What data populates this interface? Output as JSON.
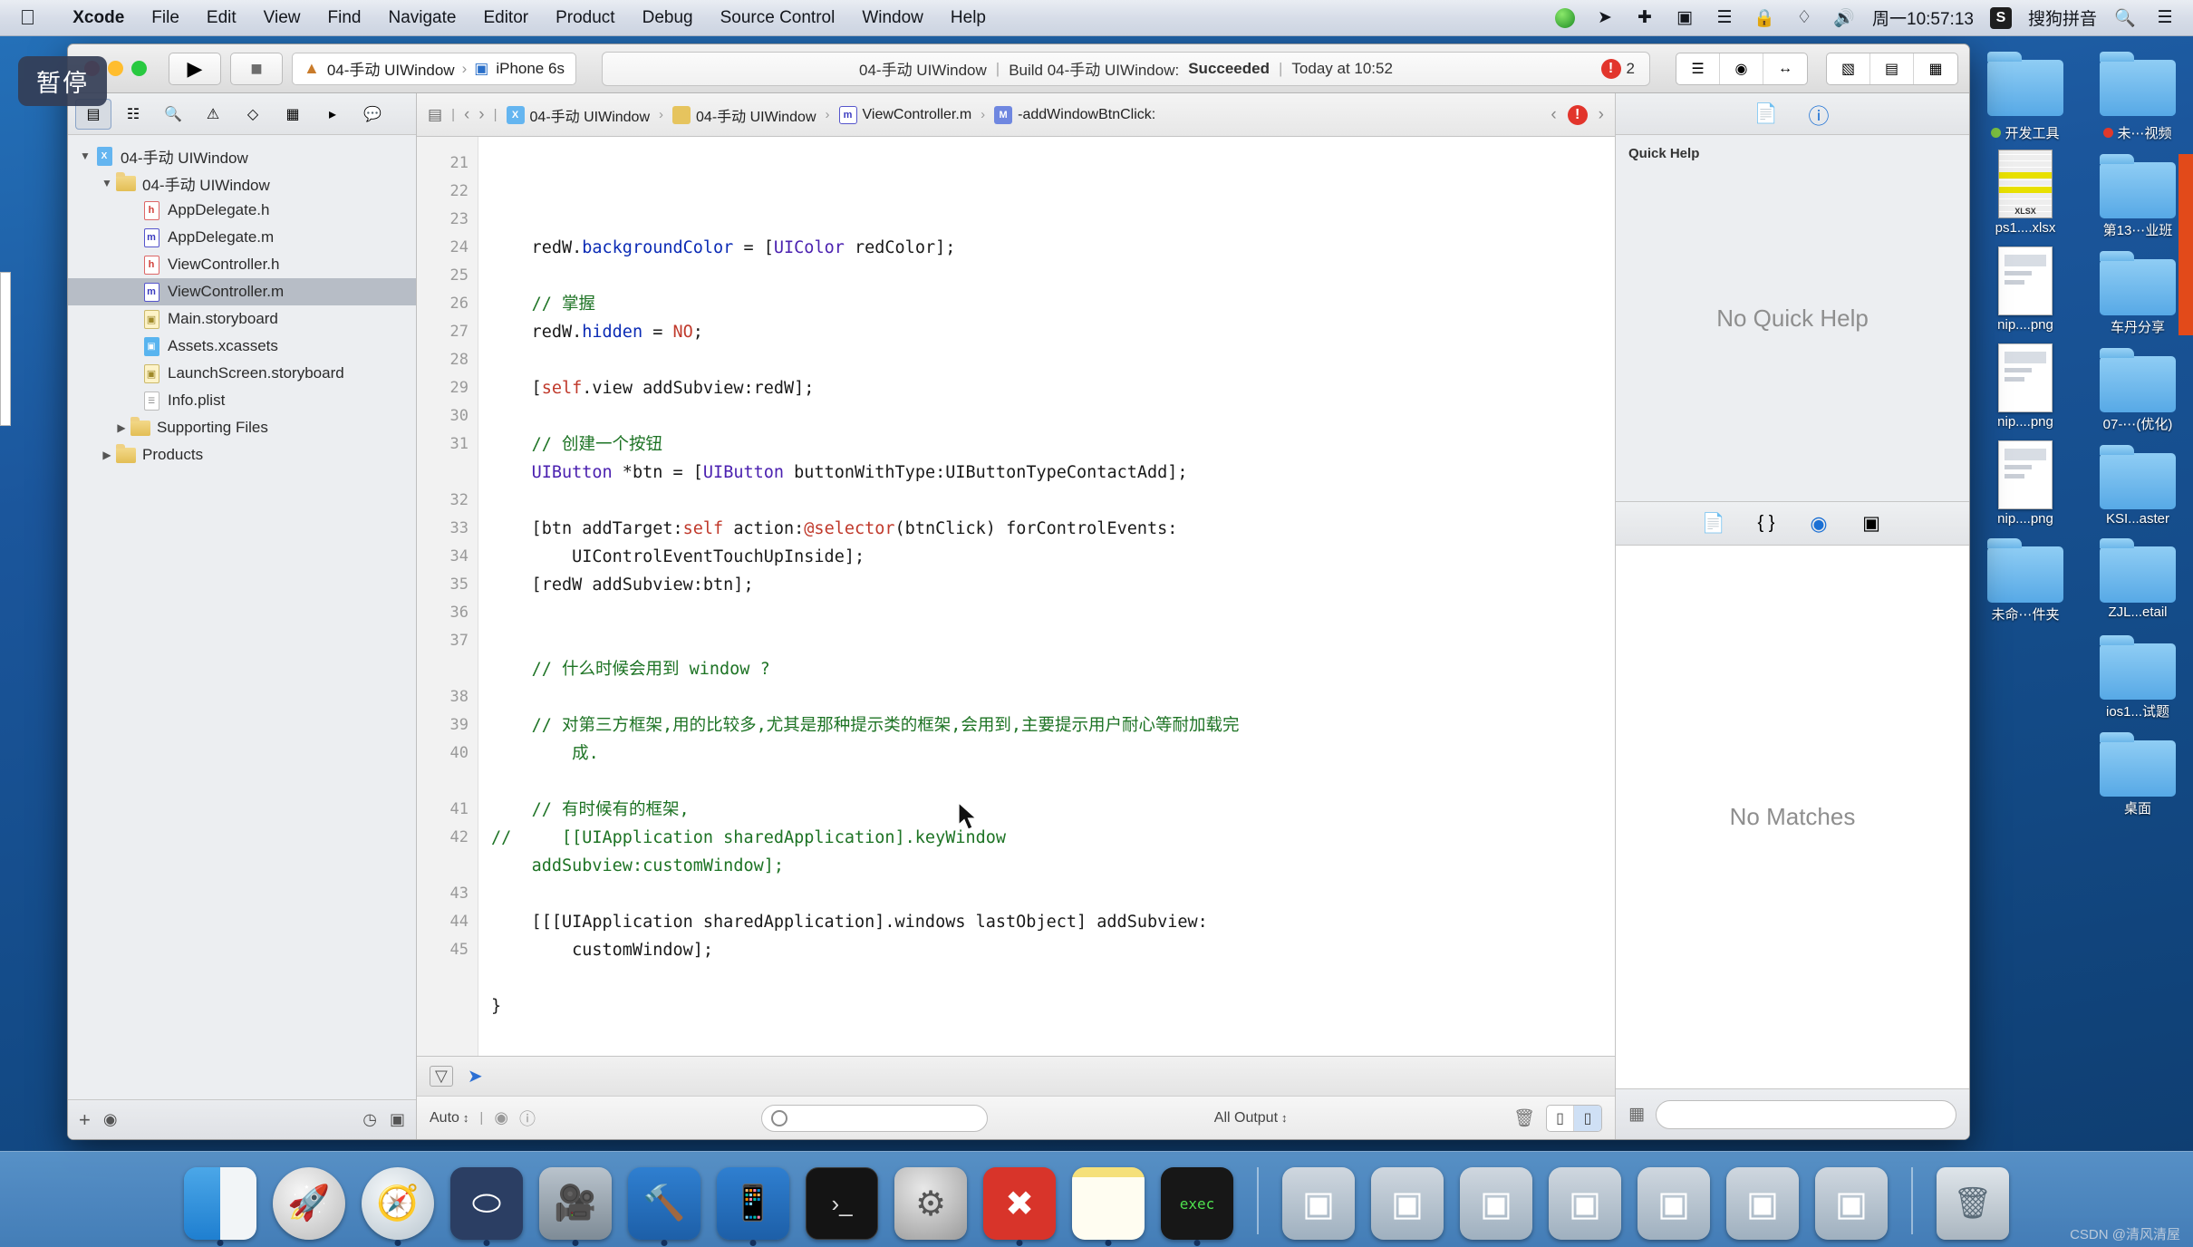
{
  "menubar": {
    "apple": "",
    "items": [
      "Xcode",
      "File",
      "Edit",
      "View",
      "Find",
      "Navigate",
      "Editor",
      "Product",
      "Debug",
      "Source Control",
      "Window",
      "Help"
    ],
    "status_icons": [
      "record-icon",
      "location-icon",
      "airplay-icon",
      "screen-record-icon",
      "audio-midi-icon",
      "lock-icon",
      "dropbox-icon",
      "volume-icon"
    ],
    "time": "周一10:57:13",
    "ime_badge": "S",
    "ime_label": "搜狗拼音",
    "search_icon": "search-icon",
    "control_center_icon": "list-icon"
  },
  "pause_badge": "暂停",
  "toolbar": {
    "run_icon": "play-icon",
    "stop_icon": "stop-icon",
    "scheme_name": "04-手动 UIWindow",
    "scheme_sep": "›",
    "destination": "iPhone 6s",
    "status_project": "04-手动 UIWindow",
    "status_build": "Build 04-手动 UIWindow:",
    "status_result": "Succeeded",
    "status_time": "Today at 10:52",
    "issue_count": "2",
    "issue_icon": "error-icon",
    "view_buttons": [
      "standard-editor-icon",
      "assistant-editor-icon",
      "version-editor-icon"
    ],
    "panel_buttons": [
      "show-navigator-icon",
      "show-debug-icon",
      "show-inspector-icon"
    ]
  },
  "navigator": {
    "tabs": [
      "project-navigator-icon",
      "symbol-navigator-icon",
      "find-navigator-icon",
      "issue-navigator-icon",
      "test-navigator-icon",
      "debug-navigator-icon",
      "breakpoint-navigator-icon",
      "report-navigator-icon"
    ],
    "active_tab": 0,
    "tree": [
      {
        "label": "04-手动 UIWindow",
        "icon": "xcode-project-icon",
        "depth": 0,
        "twisty": "▼",
        "selected": false
      },
      {
        "label": "04-手动 UIWindow",
        "icon": "folder-icon",
        "depth": 1,
        "twisty": "▼",
        "selected": false
      },
      {
        "label": "AppDelegate.h",
        "icon": "header-file-icon",
        "depth": 2,
        "twisty": "",
        "selected": false
      },
      {
        "label": "AppDelegate.m",
        "icon": "impl-file-icon",
        "depth": 2,
        "twisty": "",
        "selected": false
      },
      {
        "label": "ViewController.h",
        "icon": "header-file-icon",
        "depth": 2,
        "twisty": "",
        "selected": false
      },
      {
        "label": "ViewController.m",
        "icon": "impl-file-icon",
        "depth": 2,
        "twisty": "",
        "selected": true
      },
      {
        "label": "Main.storyboard",
        "icon": "storyboard-icon",
        "depth": 2,
        "twisty": "",
        "selected": false
      },
      {
        "label": "Assets.xcassets",
        "icon": "assets-icon",
        "depth": 2,
        "twisty": "",
        "selected": false
      },
      {
        "label": "LaunchScreen.storyboard",
        "icon": "storyboard-icon",
        "depth": 2,
        "twisty": "",
        "selected": false
      },
      {
        "label": "Info.plist",
        "icon": "plist-icon",
        "depth": 2,
        "twisty": "",
        "selected": false
      },
      {
        "label": "Supporting Files",
        "icon": "folder-icon",
        "depth": 2,
        "twisty": "▶",
        "selected": false
      },
      {
        "label": "Products",
        "icon": "folder-icon",
        "depth": 1,
        "twisty": "▶",
        "selected": false
      }
    ],
    "bottom": {
      "add_icon": "plus-icon",
      "filter_icon": "filter-icon",
      "recent_icon": "clock-icon",
      "unsaved_icon": "edited-icon"
    }
  },
  "jumpbar": {
    "related_icon": "related-items-icon",
    "back_icon": "back-chevron-icon",
    "forward_icon": "forward-chevron-icon",
    "crumbs": [
      {
        "label": "04-手动 UIWindow",
        "icon": "project-icon"
      },
      {
        "label": "04-手动 UIWindow",
        "icon": "folder-icon"
      },
      {
        "label": "ViewController.m",
        "icon": "impl-file-icon"
      },
      {
        "label": "-addWindowBtnClick:",
        "icon": "method-icon"
      }
    ],
    "prev_issue_icon": "left-chevron-icon",
    "issue_icon": "error-icon",
    "next_issue_icon": "right-chevron-icon"
  },
  "code": {
    "first_line": 21,
    "lines": [
      {
        "n": 21,
        "html": "    redW.<span class='k'>backgroundColor</span> = [<span class='t'>UIColor</span> redColor];",
        "error": false
      },
      {
        "n": 22,
        "html": "",
        "error": false
      },
      {
        "n": 23,
        "html": "    <span class='c'>// 掌握</span>",
        "error": false
      },
      {
        "n": 24,
        "html": "    redW.<span class='k'>hidden</span> = <span class='red'>NO</span>;",
        "error": false
      },
      {
        "n": 25,
        "html": "",
        "error": false
      },
      {
        "n": 26,
        "html": "    [<span class='red'>self</span>.view addSubview:redW];",
        "error": false
      },
      {
        "n": 27,
        "html": "",
        "error": false
      },
      {
        "n": 28,
        "html": "    <span class='c'>// 创建一个按钮</span>",
        "error": false
      },
      {
        "n": 29,
        "html": "    <span class='t'>UIButton</span> *btn = [<span class='t'>UIButton</span> buttonWithType:UIButtonTypeContactAdd];",
        "error": false
      },
      {
        "n": 30,
        "html": "",
        "error": false
      },
      {
        "n": 31,
        "html": "    [btn addTarget:<span class='red'>self</span> action:<span class='red'>@selector</span>(btnClick) forControlEvents:",
        "error": false
      },
      {
        "n": "",
        "html": "        UIControlEventTouchUpInside];",
        "error": false
      },
      {
        "n": 32,
        "html": "    [redW addSubview:btn];",
        "error": false
      },
      {
        "n": 33,
        "html": "",
        "error": false
      },
      {
        "n": 34,
        "html": "",
        "error": false
      },
      {
        "n": 35,
        "html": "    <span class='c'>// 什么时候会用到 window ?</span>",
        "error": false
      },
      {
        "n": 36,
        "html": "",
        "error": false
      },
      {
        "n": 37,
        "html": "    <span class='c'>// 对第三方框架,用的比较多,尤其是那种提示类的框架,会用到,主要提示用户耐心等耐加载完</span>",
        "error": false
      },
      {
        "n": "",
        "html": "        <span class='c'>成.</span>",
        "error": false
      },
      {
        "n": 38,
        "html": "",
        "error": false
      },
      {
        "n": 39,
        "html": "    <span class='c'>// 有时候有的框架,</span>",
        "error": false
      },
      {
        "n": 40,
        "html": "<span class='c'>//     [[UIApplication sharedApplication].keyWindow</span>",
        "error": false
      },
      {
        "n": "",
        "html": "    <span class='c'>addSubview:customWindow];</span>",
        "error": false
      },
      {
        "n": 41,
        "html": "",
        "error": false
      },
      {
        "n": 42,
        "html": "    [[[UIApplication sharedApplication].windows lastObject] addSubview:",
        "error": false
      },
      {
        "n": "",
        "html": "        customWindow];",
        "error": false
      },
      {
        "n": 43,
        "html": "",
        "error": false
      },
      {
        "n": 44,
        "html": "}",
        "error": true
      },
      {
        "n": 45,
        "html": "",
        "error": false
      }
    ]
  },
  "editor_bottom": {
    "filter_icon": "filter-icon",
    "breakpoint_icon": "breakpoint-icon"
  },
  "debug": {
    "variables_scope": "Auto",
    "scope_chevron": "⌃",
    "watch_icon": "eye-icon",
    "info_icon": "info-icon",
    "var_filter_placeholder": "",
    "console_scope": "All Output",
    "console_chevron": "⌃",
    "trash_icon": "trash-icon",
    "split_icon": "split-panes-icon"
  },
  "inspector": {
    "tabs": [
      "file-inspector-icon",
      "quick-help-icon"
    ],
    "active_tab": 1,
    "section_title": "Quick Help",
    "empty_message": "No Quick Help",
    "library_tabs": [
      "file-template-library-icon",
      "code-snippet-library-icon",
      "object-library-icon",
      "media-library-icon"
    ],
    "library_active": 2,
    "library_empty": "No Matches",
    "library_filter_placeholder": "",
    "list_view_icon": "list-view-icon",
    "filter_icon": "filter-icon"
  },
  "desktop_icons": [
    {
      "label": "",
      "type": "folder"
    },
    {
      "label": "",
      "type": "folder"
    },
    {
      "label": "开发工具",
      "type": "label-green"
    },
    {
      "label": "未⋯视频",
      "type": "label-red"
    },
    {
      "label": "ps1....xlsx",
      "type": "xlsx"
    },
    {
      "label": "第13⋯业班",
      "type": "folder"
    },
    {
      "label": "nip....png",
      "type": "png"
    },
    {
      "label": "车丹分享",
      "type": "folder"
    },
    {
      "label": "nip....png",
      "type": "png"
    },
    {
      "label": "07-⋯(优化)",
      "type": "folder"
    },
    {
      "label": "nip....png",
      "type": "png"
    },
    {
      "label": "KSI...aster",
      "type": "folder"
    },
    {
      "label": "未命⋯件夹",
      "type": "folder"
    },
    {
      "label": "ZJL...etail",
      "type": "folder"
    },
    {
      "label": "",
      "type": "spacer"
    },
    {
      "label": "ios1...试题",
      "type": "folder"
    },
    {
      "label": "",
      "type": "spacer"
    },
    {
      "label": "桌面",
      "type": "folder"
    }
  ],
  "dock": {
    "items": [
      {
        "name": "Finder",
        "cls": "finder",
        "glyph": "",
        "running": true
      },
      {
        "name": "Launchpad",
        "cls": "launch",
        "glyph": "🚀",
        "running": false
      },
      {
        "name": "Safari",
        "cls": "safari",
        "glyph": "🧭",
        "running": true
      },
      {
        "name": "Mouse Utility",
        "cls": "mouse",
        "glyph": "⬭",
        "running": true
      },
      {
        "name": "QuickTime Player",
        "cls": "qt",
        "glyph": "🎬",
        "running": true
      },
      {
        "name": "Xcode",
        "cls": "xcode",
        "glyph": "🔨",
        "running": true
      },
      {
        "name": "Xcode Simulator",
        "cls": "xcode",
        "glyph": "📱",
        "running": true
      },
      {
        "name": "Terminal",
        "cls": "term",
        "glyph": "›_",
        "running": false
      },
      {
        "name": "System Preferences",
        "cls": "pref",
        "glyph": "⚙",
        "running": false
      },
      {
        "name": "XMind",
        "cls": "xmind",
        "glyph": "✖",
        "running": true
      },
      {
        "name": "Notes",
        "cls": "notes",
        "glyph": "",
        "running": true
      },
      {
        "name": "Executable",
        "cls": "exec",
        "glyph": "exec",
        "running": true
      }
    ],
    "minimized": [
      {
        "name": "Simulator Window 1",
        "cls": "win"
      },
      {
        "name": "Simulator Window 2",
        "cls": "win"
      },
      {
        "name": "Simulator Window 3",
        "cls": "win"
      },
      {
        "name": "Simulator Window 4",
        "cls": "win"
      },
      {
        "name": "Simulator Window 5",
        "cls": "win"
      },
      {
        "name": "Simulator Window 6",
        "cls": "win"
      },
      {
        "name": "Document Window",
        "cls": "win"
      }
    ],
    "trash": {
      "name": "Trash",
      "cls": "trash",
      "glyph": "🗑"
    }
  },
  "watermark": "CSDN @清风清屋"
}
